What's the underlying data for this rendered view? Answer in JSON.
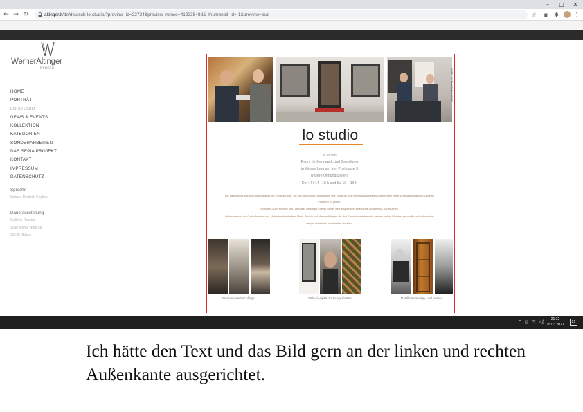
{
  "browser": {
    "url_host": "altinger.it",
    "url_path": "/de/deutsch-lo-studio/?preview_id=22724&preview_nonce=41923548d&_thumbnail_id=-1&preview=true",
    "back_icon": "arrow-left-icon",
    "forward_icon": "arrow-right-icon",
    "reload_icon": "reload-icon"
  },
  "window_controls": {
    "minimize": "–",
    "maximize": "▢",
    "close": "✕"
  },
  "site": {
    "logo_name": "WernerAltinger",
    "logo_sub": "Firenze",
    "menu": [
      {
        "label": "HOME",
        "active": false
      },
      {
        "label": "PORTRÄT",
        "active": false
      },
      {
        "label": "LO STUDIO",
        "active": true
      },
      {
        "label": "NEWS & EVENTS",
        "active": false
      },
      {
        "label": "KOLLEKTION",
        "active": false
      },
      {
        "label": "KATEGORIEN",
        "active": false
      },
      {
        "label": "SONDERARBEITEN",
        "active": false
      },
      {
        "label": "DAS SEPIA PROJEKT",
        "active": false
      },
      {
        "label": "KONTAKT",
        "active": false
      },
      {
        "label": "IMPRESSUM",
        "active": false
      },
      {
        "label": "DATENSCHUTZ",
        "active": false
      }
    ],
    "language_heading": "Sprache",
    "languages": "Italiano Deutsch English",
    "exhibit_heading": "Dauerausstellung",
    "exhibit_lines": [
      "Galleria Rossini",
      "Viale Monte Nero 58",
      "20135 Milano"
    ]
  },
  "page": {
    "title": "lo studio",
    "photo_credit": "FOTO: KATHARINA HEINE",
    "address_lines": [
      "lo studio",
      "Raum für Handwerk und Gestaltung",
      "in Wasserburg am Inn, Postgasse 3",
      "Unsere Öffnungszeiten:",
      "Do + Fr 14 –18 h und Sa 10 – 16 h"
    ],
    "body_lines": [
      "Die Idee kommt aus der Notwendigkeit, für kreative Leute, die sich gewöhnlich auf Messen ihre Designer- und Kunsthandwerkermärkten zeigen in der veranstaltungslosen Zeit eine",
      "Plattform zu geben.",
      "So haben auch Kunden und Liebhaber derartiger Events wieder eine Möglichkeit, eine kleine Ausstellung zu besuchen.",
      "Initiatoren sind die Goldschmiede und „Vielseitwerkeinheiten“ Maria Stöckle und Werner Altinger, die dort Sammlausstellen sein werden und im Wechsel geschaffe und befreundete",
      "design-orientierte Handwerker einladen."
    ],
    "captions": [
      "Schmuck, Werner Altinger",
      "Malerei, digital Art, Lenny Sietsten",
      "Metallmöbeldesign, Axel Kessen"
    ]
  },
  "taskbar": {
    "time": "21:12",
    "date": "18.03.2021",
    "tray_icons": [
      "chevron-up-icon",
      "battery-icon",
      "network-icon",
      "volume-icon"
    ],
    "notification_count": "21"
  },
  "comment": "Ich hätte den Text und das Bild gern an der linken und rechten Außenkante ausgerichtet.",
  "colors": {
    "accent_red": "#d93025",
    "underline_orange": "#e9862b",
    "admin_bar": "#2b2b2b"
  }
}
